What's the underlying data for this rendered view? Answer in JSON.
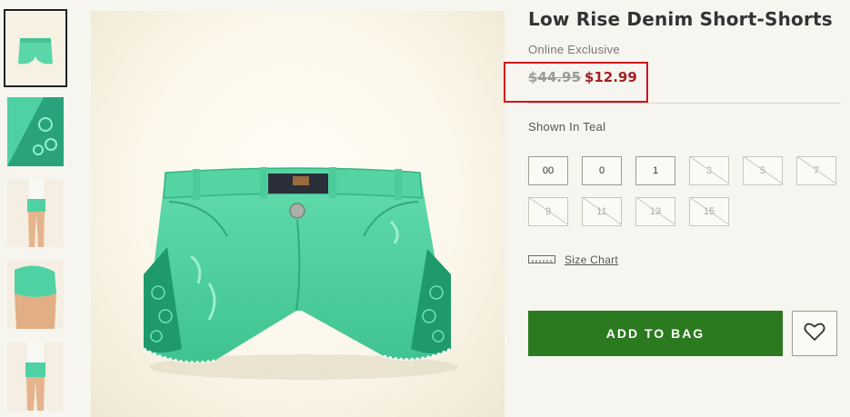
{
  "product": {
    "title": "Low Rise Denim Short-Shorts",
    "badge": "Online Exclusive",
    "original_price": "$44.95",
    "sale_price": "$12.99",
    "color_label": "Shown In Teal"
  },
  "sizes": [
    {
      "label": "00",
      "available": true
    },
    {
      "label": "0",
      "available": true
    },
    {
      "label": "1",
      "available": true
    },
    {
      "label": "3",
      "available": false
    },
    {
      "label": "5",
      "available": false
    },
    {
      "label": "7",
      "available": false
    },
    {
      "label": "9",
      "available": false
    },
    {
      "label": "11",
      "available": false
    },
    {
      "label": "13",
      "available": false
    },
    {
      "label": "15",
      "available": false
    }
  ],
  "size_chart_label": "Size Chart",
  "add_to_bag_label": "ADD TO BAG",
  "colors": {
    "accent_green": "#2b7a1f",
    "sale_red": "#a51f22",
    "highlight_red": "#d0121b",
    "product_teal": "#4fd1a3"
  },
  "icons": {
    "wishlist": "heart-icon",
    "size_chart": "ruler-icon"
  }
}
